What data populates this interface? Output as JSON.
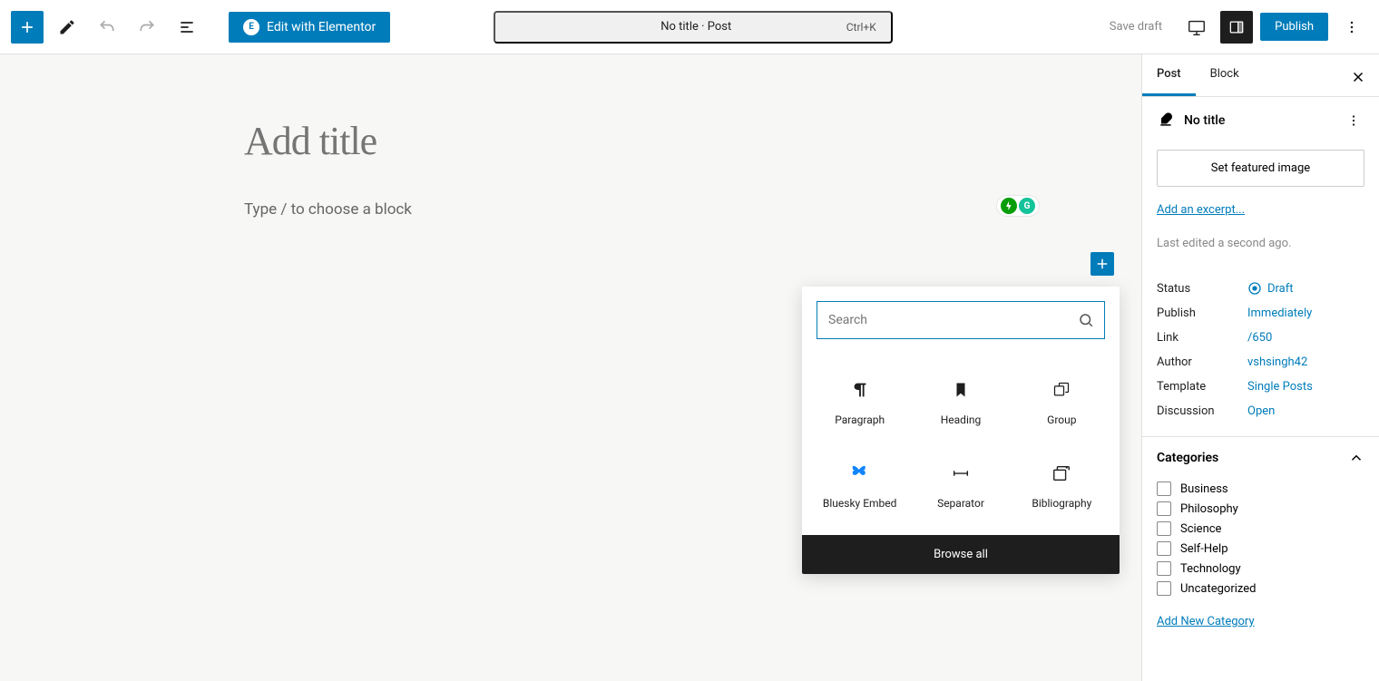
{
  "toolbar": {
    "elementor_label": "Edit with Elementor",
    "command_title": "No title · Post",
    "command_shortcut": "Ctrl+K",
    "save_draft": "Save draft",
    "publish": "Publish"
  },
  "canvas": {
    "title_placeholder": "Add title",
    "body_placeholder": "Type / to choose a block"
  },
  "inserter": {
    "search_placeholder": "Search",
    "blocks": [
      {
        "name": "Paragraph",
        "icon": "paragraph"
      },
      {
        "name": "Heading",
        "icon": "bookmark"
      },
      {
        "name": "Group",
        "icon": "group"
      },
      {
        "name": "Bluesky Embed",
        "icon": "butterfly"
      },
      {
        "name": "Separator",
        "icon": "separator"
      },
      {
        "name": "Bibliography",
        "icon": "bibliography"
      }
    ],
    "browse_all": "Browse all"
  },
  "sidebar": {
    "tabs": {
      "post": "Post",
      "block": "Block"
    },
    "post_title": "No title",
    "featured_image": "Set featured image",
    "add_excerpt": "Add an excerpt...",
    "last_edited": "Last edited a second ago.",
    "meta": {
      "status": {
        "label": "Status",
        "value": "Draft"
      },
      "publish": {
        "label": "Publish",
        "value": "Immediately"
      },
      "link": {
        "label": "Link",
        "value": "/650"
      },
      "author": {
        "label": "Author",
        "value": "vshsingh42"
      },
      "template": {
        "label": "Template",
        "value": "Single Posts"
      },
      "discussion": {
        "label": "Discussion",
        "value": "Open"
      }
    },
    "categories": {
      "header": "Categories",
      "items": [
        "Business",
        "Philosophy",
        "Science",
        "Self-Help",
        "Technology",
        "Uncategorized"
      ],
      "add_new": "Add New Category"
    }
  }
}
